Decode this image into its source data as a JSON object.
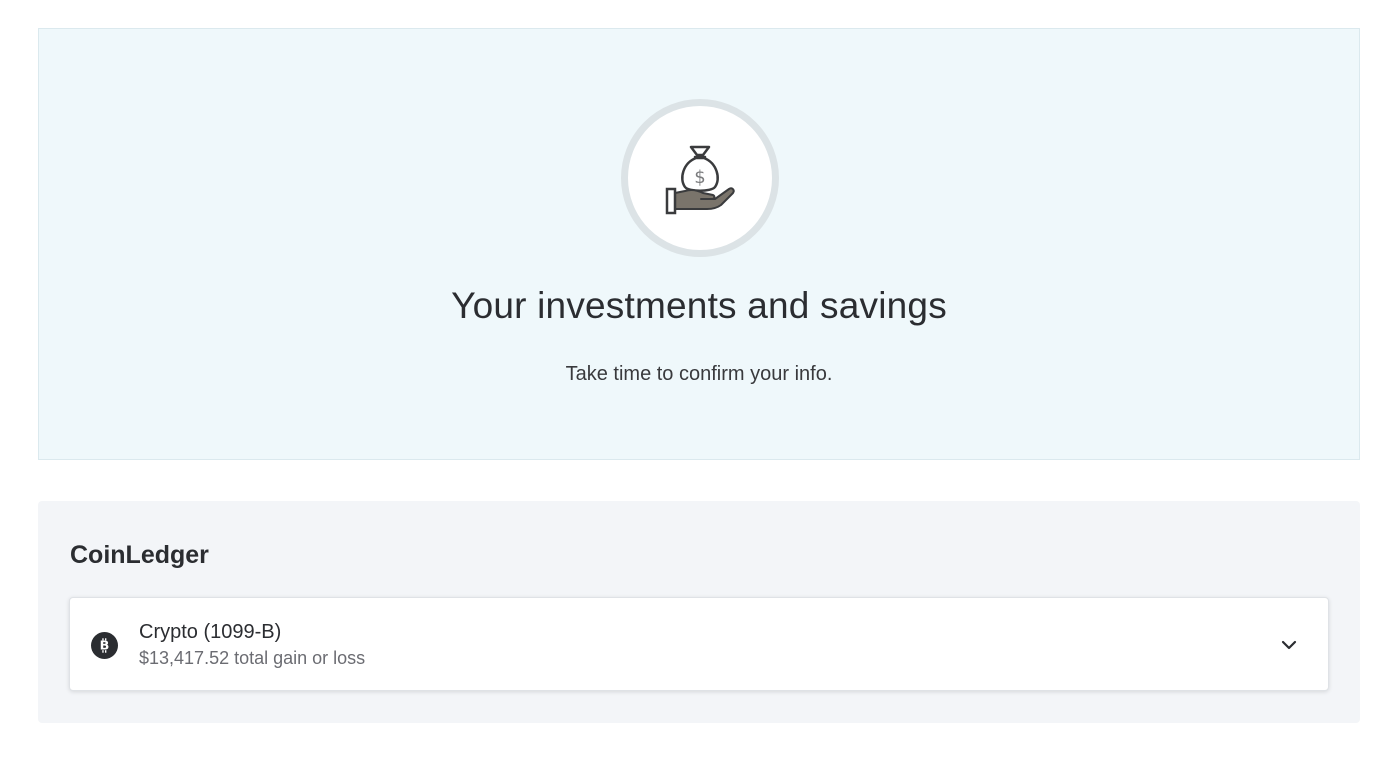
{
  "hero": {
    "icon": "money-bag-hand-icon",
    "title": "Your investments and savings",
    "subtitle": "Take time to confirm your info."
  },
  "section": {
    "title": "CoinLedger",
    "items": [
      {
        "icon": "bitcoin-icon",
        "title": "Crypto (1099-B)",
        "subtitle": "$13,417.52 total gain or loss",
        "expand_icon": "chevron-down-icon"
      }
    ]
  },
  "colors": {
    "hero_background": "#eff8fb",
    "section_background": "#f3f5f8",
    "text_primary": "#2b2d31",
    "text_secondary": "#6b6c72"
  }
}
